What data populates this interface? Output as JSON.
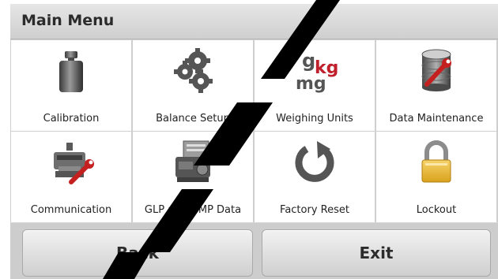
{
  "header": {
    "title": "Main Menu"
  },
  "tiles": [
    {
      "label": "Calibration",
      "icon": "weight-icon"
    },
    {
      "label": "Balance Setup",
      "icon": "gears-icon"
    },
    {
      "label": "Weighing Units",
      "icon": "units-icon",
      "icon_text": {
        "g": "g",
        "kg": "kg",
        "mg": "mg"
      }
    },
    {
      "label": "Data Maintenance",
      "icon": "database-wrench-icon"
    },
    {
      "label": "Communication",
      "icon": "printer-wrench-icon"
    },
    {
      "label": "GLP and GMP Data",
      "icon": "glp-printer-icon"
    },
    {
      "label": "Factory Reset",
      "icon": "reset-arrow-icon"
    },
    {
      "label": "Lockout",
      "icon": "padlock-icon"
    }
  ],
  "buttons": {
    "back": "Back",
    "exit": "Exit"
  },
  "colors": {
    "background": "#d7d7d7",
    "tile": "#ffffff",
    "units_red": "#c0202c",
    "watermark": "#000000"
  }
}
